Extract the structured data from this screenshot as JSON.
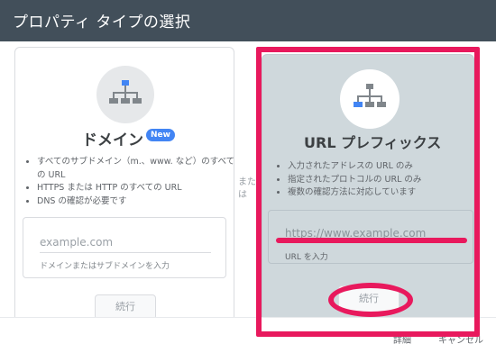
{
  "dialog": {
    "title": "プロパティ タイプの選択"
  },
  "domain_card": {
    "icon": "sitemap-icon",
    "title": "ドメイン",
    "badge": "New",
    "features": [
      "すべてのサブドメイン（m.、www. など）のすべての URL",
      "HTTPS または HTTP のすべての URL",
      "DNS の確認が必要です"
    ],
    "input_placeholder": "example.com",
    "helper": "ドメインまたはサブドメインを入力",
    "continue": "続行"
  },
  "or_text": "また は",
  "url_prefix_card": {
    "icon": "sitemap-icon",
    "title": "URL プレフィックス",
    "features": [
      "入力されたアドレスの URL のみ",
      "指定されたプロトコルの URL のみ",
      "複数の確認方法に対応しています"
    ],
    "input_placeholder": "https://www.example.com",
    "helper": "URL を入力",
    "continue": "続行"
  },
  "footer": {
    "details": "詳細",
    "cancel": "キャンセル"
  },
  "colors": {
    "header_bg": "#424f5a",
    "highlight": "#e8195d",
    "selected_card_bg": "#cfd8dc",
    "icon_accent": "#4285f4"
  }
}
